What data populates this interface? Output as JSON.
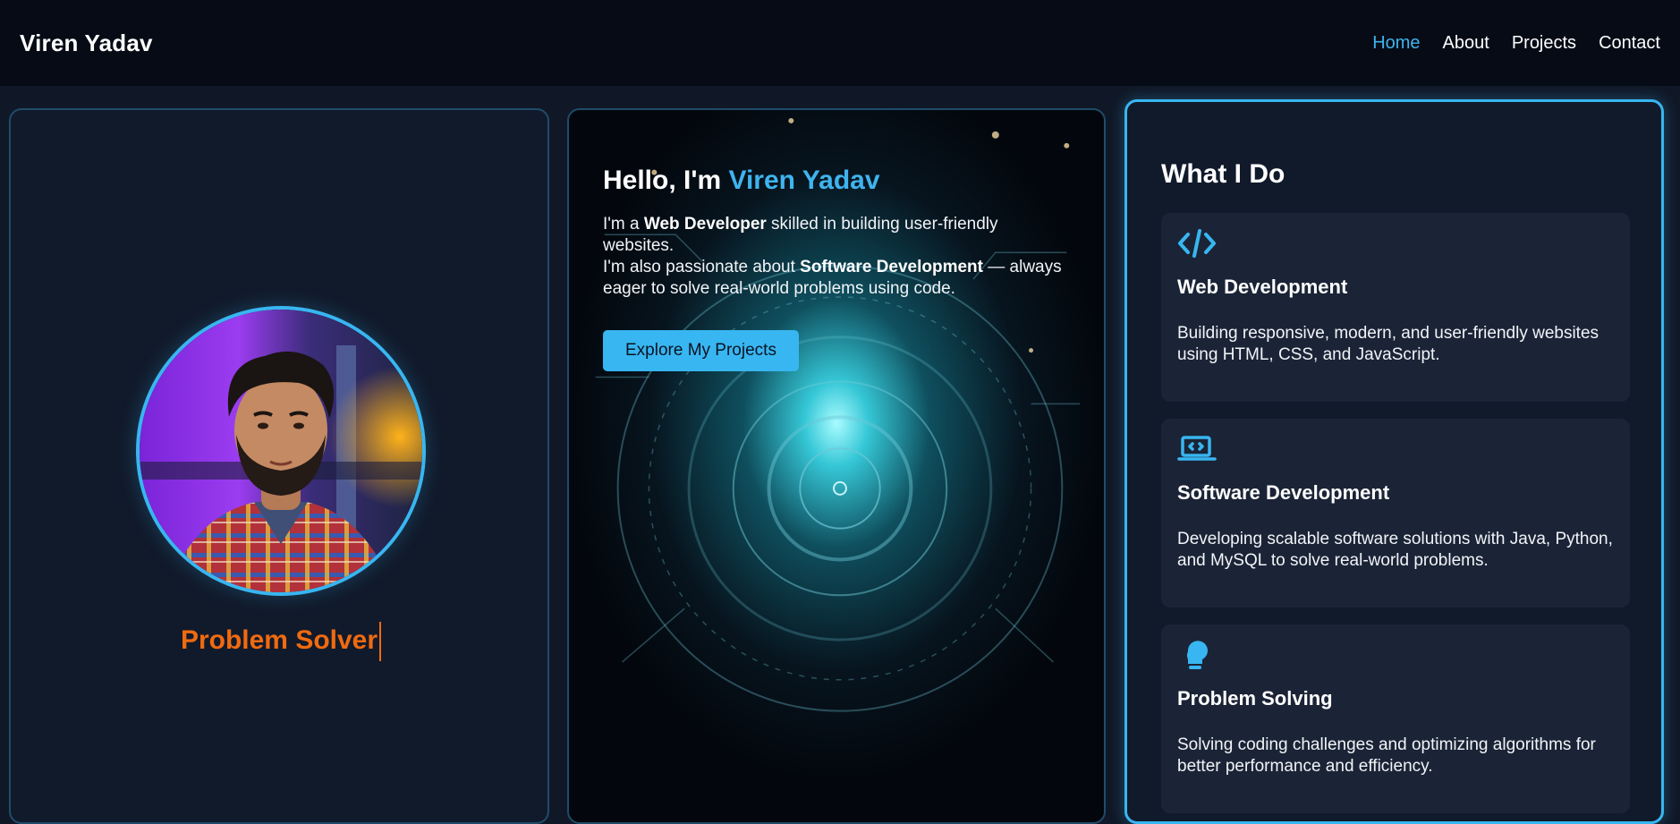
{
  "nav": {
    "brand": "Viren Yadav",
    "links": [
      {
        "label": "Home",
        "active": true
      },
      {
        "label": "About",
        "active": false
      },
      {
        "label": "Projects",
        "active": false
      },
      {
        "label": "Contact",
        "active": false
      }
    ]
  },
  "profile": {
    "avatar_icon": "profile-photo",
    "role_text": "Problem Solver",
    "role_color": "#f06a10"
  },
  "hero": {
    "greeting": "Hello, I'm ",
    "name": "Viren Yadav",
    "line1_a": "I'm a ",
    "line1_bold": "Web Developer",
    "line1_b": " skilled in building user-friendly websites.",
    "line2_a": "I'm also passionate about ",
    "line2_bold": "Software Development",
    "line2_b": " — always eager to solve real-world problems using code.",
    "cta_label": "Explore My Projects"
  },
  "services": {
    "title": "What I Do",
    "items": [
      {
        "icon": "code-icon",
        "title": "Web Development",
        "desc": "Building responsive, modern, and user-friendly websites using HTML, CSS, and JavaScript."
      },
      {
        "icon": "laptop-code-icon",
        "title": "Software Development",
        "desc": "Developing scalable software solutions with Java, Python, and MySQL to solve real-world problems."
      },
      {
        "icon": "lightbulb-icon",
        "title": "Problem Solving",
        "desc": "Solving coding challenges and optimizing algorithms for better performance and efficiency."
      }
    ]
  },
  "colors": {
    "accent": "#38b6f1",
    "background": "#101827",
    "navbar": "#060b16",
    "card": "#111a2b",
    "service_card": "#1b2436",
    "role_orange": "#f06a10"
  }
}
